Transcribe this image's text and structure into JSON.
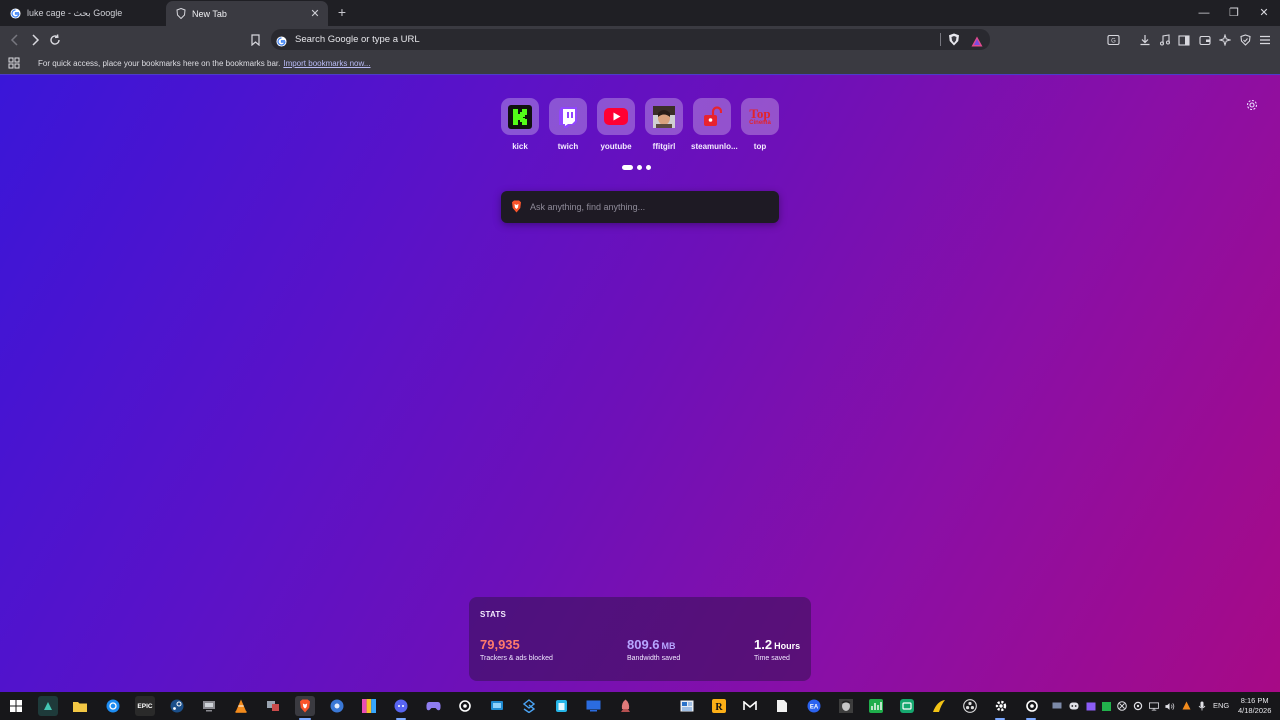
{
  "tabs": [
    {
      "title": "luke cage - بحث Google",
      "icon": "google-g-icon",
      "active": false
    },
    {
      "title": "New Tab",
      "icon": "brave-shield-icon",
      "active": true
    }
  ],
  "omnibox": {
    "placeholder": "Search Google or type a URL"
  },
  "bookmarks_bar": {
    "message": "For quick access, place your bookmarks here on the bookmarks bar.",
    "import_link": "Import bookmarks now..."
  },
  "top_sites": [
    {
      "label": "kick",
      "icon": "kick-icon"
    },
    {
      "label": "twich",
      "icon": "twitch-icon"
    },
    {
      "label": "youtube",
      "icon": "youtube-icon"
    },
    {
      "label": "ffitgirl",
      "icon": "fitgirl-avatar-icon"
    },
    {
      "label": "steamunlo...",
      "icon": "steamunlocked-icon"
    },
    {
      "label": "top",
      "icon": "topcinema-icon",
      "logo_line1": "Top",
      "logo_line2": "Cinema"
    }
  ],
  "pagination": {
    "pages": 3,
    "current": 1
  },
  "ai_search": {
    "placeholder": "Ask anything, find anything..."
  },
  "stats": {
    "heading": "STATS",
    "trackers": {
      "value": "79,935",
      "label": "Trackers & ads blocked",
      "color": "#ff7a6b"
    },
    "bandwidth": {
      "value": "809.6",
      "unit": "MB",
      "label": "Bandwidth saved",
      "color": "#b7a6ff"
    },
    "time": {
      "value": "1.2",
      "unit": "Hours",
      "label": "Time saved",
      "color": "#ffffff"
    }
  },
  "taskbar": {
    "epic_label": "EPIC",
    "language": "ENG",
    "time": "8:16 PM",
    "date": "4/18/2026"
  },
  "colors": {
    "page_gradient_start": "#3a16d8",
    "page_gradient_end": "#a70a86",
    "toolbar": "#3a3a41",
    "tabstrip": "#1f1f24"
  }
}
